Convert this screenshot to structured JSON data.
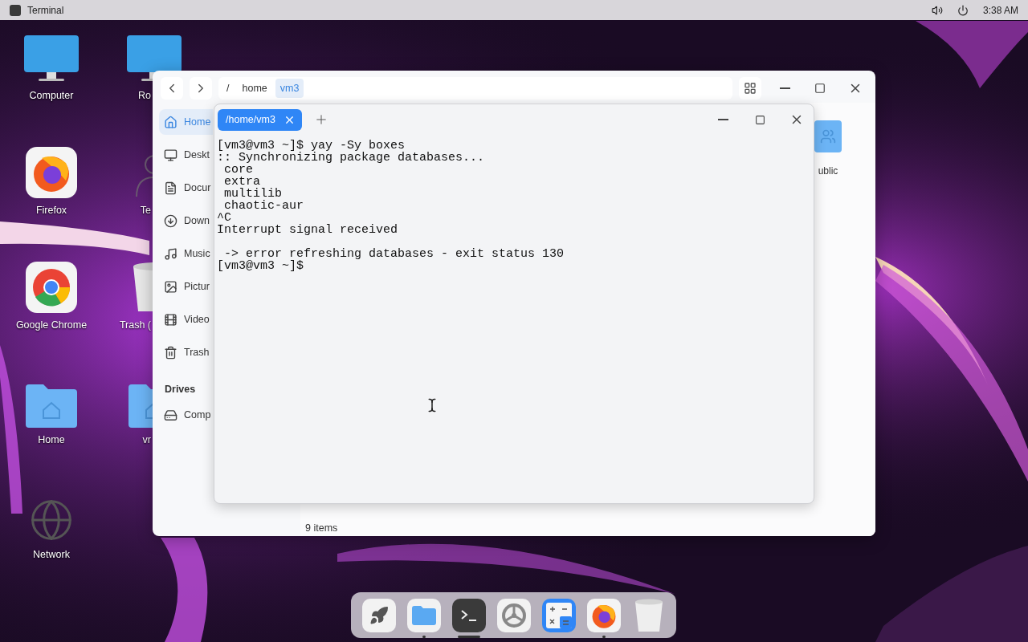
{
  "top_bar": {
    "app_title": "Terminal",
    "clock": "3:38 AM"
  },
  "desktop_icons": [
    {
      "label": "Computer",
      "kind": "monitor"
    },
    {
      "label": "Ro",
      "kind": "monitor"
    },
    {
      "label": "Firefox",
      "kind": "firefox"
    },
    {
      "label": "Te",
      "kind": "person"
    },
    {
      "label": "Google Chrome",
      "kind": "chrome"
    },
    {
      "label": "Trash (",
      "kind": "trash"
    },
    {
      "label": "Home",
      "kind": "folder"
    },
    {
      "label": "vr",
      "kind": "folder"
    },
    {
      "label": "Network",
      "kind": "network"
    }
  ],
  "file_manager": {
    "breadcrumb": [
      {
        "label": "/",
        "selected": false
      },
      {
        "label": "home",
        "selected": false
      },
      {
        "label": "vm3",
        "selected": true
      }
    ],
    "sidebar": [
      {
        "label": "Home",
        "kind": "home",
        "selected": true
      },
      {
        "label": "Deskt",
        "kind": "desktop",
        "selected": false
      },
      {
        "label": "Docur",
        "kind": "document",
        "selected": false
      },
      {
        "label": "Down",
        "kind": "download",
        "selected": false
      },
      {
        "label": "Music",
        "kind": "music",
        "selected": false
      },
      {
        "label": "Pictur",
        "kind": "picture",
        "selected": false
      },
      {
        "label": "Video",
        "kind": "video",
        "selected": false
      },
      {
        "label": "Trash",
        "kind": "trash",
        "selected": false
      }
    ],
    "drives_heading": "Drives",
    "drives": [
      {
        "label": "Comp",
        "selected": false
      }
    ],
    "folders": [
      {
        "label": "ublic"
      }
    ],
    "status": "9 items"
  },
  "terminal": {
    "tabs": [
      {
        "label": "/home/vm3",
        "selected": true
      }
    ],
    "output_blocks": [
      [
        "[vm3@vm3 ~]$ yay -Sy boxes",
        ":: Synchronizing package databases...",
        " core",
        " extra",
        " multilib",
        " chaotic-aur",
        "^C",
        "Interrupt signal received"
      ],
      [
        " -> error refreshing databases - exit status 130",
        "[vm3@vm3 ~]$"
      ]
    ]
  },
  "dock": [
    {
      "kind": "launcher",
      "running": false,
      "active": false
    },
    {
      "kind": "files",
      "running": true,
      "active": false
    },
    {
      "kind": "terminal",
      "running": true,
      "active": true
    },
    {
      "kind": "settings",
      "running": false,
      "active": false
    },
    {
      "kind": "calculator",
      "running": false,
      "active": false
    },
    {
      "kind": "firefox",
      "running": true,
      "active": false
    },
    {
      "kind": "trash",
      "running": false,
      "active": false
    }
  ]
}
